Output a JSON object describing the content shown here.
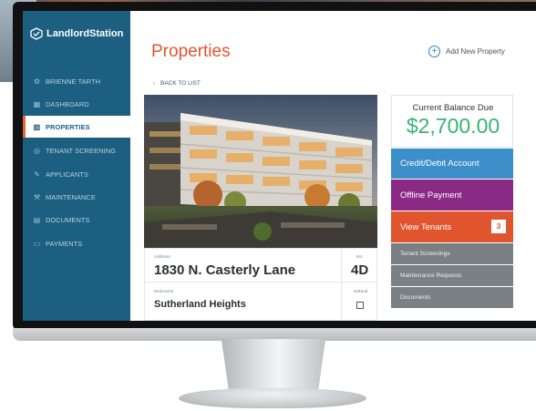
{
  "app": {
    "logo_text": "LandlordStation"
  },
  "sidebar": {
    "items": [
      {
        "label": "BRIENNE TARTH",
        "icon": "gear-icon"
      },
      {
        "label": "DASHBOARD",
        "icon": "grid-icon"
      },
      {
        "label": "PROPERTIES",
        "icon": "building-icon",
        "active": true
      },
      {
        "label": "TENANT SCREENING",
        "icon": "magnifier-icon"
      },
      {
        "label": "APPLICANTS",
        "icon": "pen-icon"
      },
      {
        "label": "MAINTENANCE",
        "icon": "wrench-icon"
      },
      {
        "label": "DOCUMENTS",
        "icon": "folder-icon"
      },
      {
        "label": "PAYMENTS",
        "icon": "card-icon"
      }
    ]
  },
  "main": {
    "title": "Properties",
    "add_property_label": "Add New Property",
    "back_label": "BACK TO LIST"
  },
  "property": {
    "address_label": "Address",
    "address": "1830 N. Casterly Lane",
    "number_label": "No.",
    "number": "4D",
    "nickname_label": "Nickname",
    "nickname": "Sutherland Heights",
    "default_label": "Default"
  },
  "account": {
    "balance_label": "Current Balance Due",
    "balance": "$2,700.00",
    "credit_label": "Credit/Debit Account",
    "offline_label": "Offline Payment",
    "view_tenants_label": "View Tenants",
    "tenant_count": "3",
    "tenant_screenings_label": "Tenant Screenings",
    "maintenance_label": "Maintenance Requests",
    "documents_label": "Documents"
  },
  "colors": {
    "sidebar": "#1c5f80",
    "accent": "#e0552e",
    "balance": "#3bb273",
    "credit": "#3c8fc9",
    "offline": "#8b2a85",
    "secondary": "#7b8084"
  }
}
